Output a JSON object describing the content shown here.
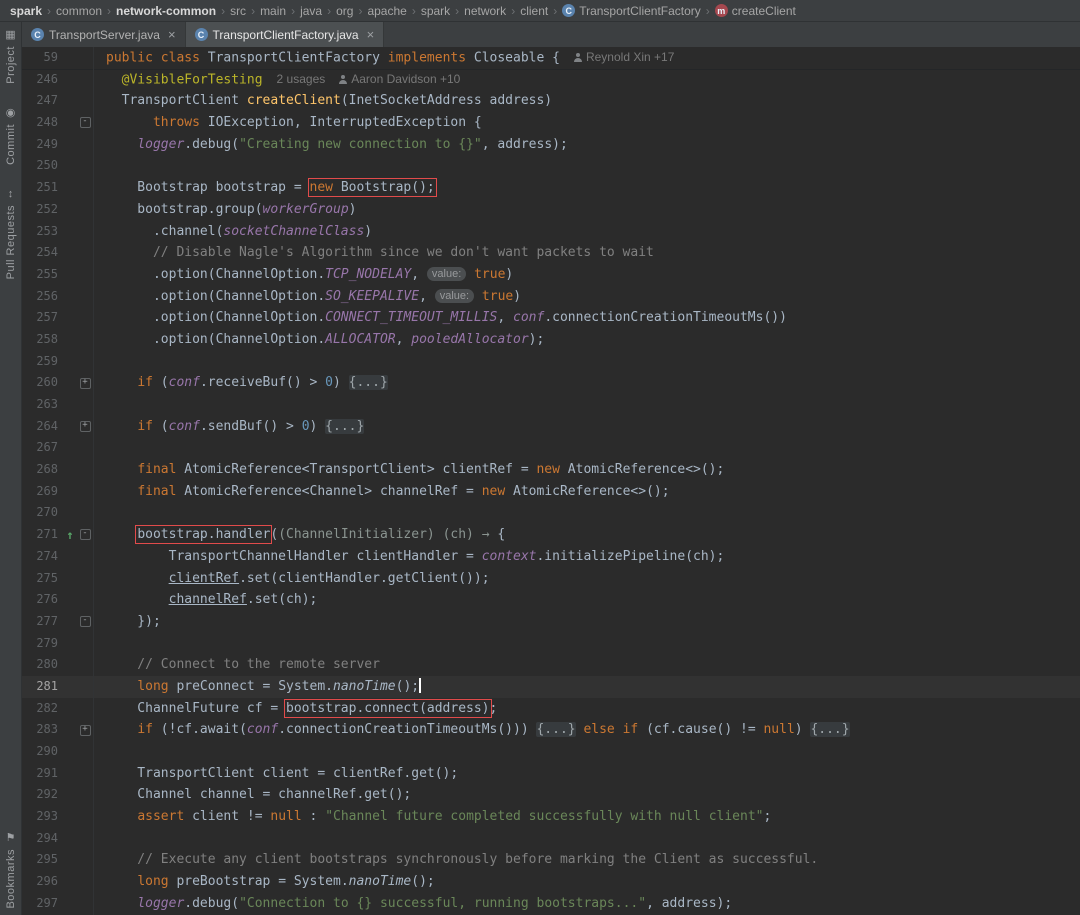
{
  "palette": {
    "editor_bg": "#2b2b2b",
    "panel_bg": "#3c3f41",
    "active_tab_bg": "#4c5052",
    "caret_row_bg": "#323232",
    "keyword": "#cc7832",
    "default_text": "#a9b7c6",
    "string": "#6a8759",
    "comment": "#808080",
    "field": "#9876aa",
    "method_decl": "#ffc66b",
    "annotation": "#bbb529",
    "number": "#6897bb",
    "line_number": "#606366",
    "inlay": "#787878",
    "highlight_box": "#e14b4b",
    "implement_marker": "#59a869"
  },
  "icons": {
    "class": "C",
    "method": "m",
    "close": "×",
    "separator": "›",
    "fold_open": "-",
    "fold_closed": "+",
    "override": "↑",
    "project": "▦",
    "commit": "◉",
    "pull-requests": "↕",
    "bookmarks": "⚑",
    "user": "css-person"
  },
  "breadcrumbs": {
    "separator": "›",
    "items": [
      {
        "label": "spark",
        "bold": true
      },
      {
        "label": "common"
      },
      {
        "label": "network-common",
        "bold": true
      },
      {
        "label": "src"
      },
      {
        "label": "main"
      },
      {
        "label": "java"
      },
      {
        "label": "org"
      },
      {
        "label": "apache"
      },
      {
        "label": "spark"
      },
      {
        "label": "network"
      },
      {
        "label": "client"
      },
      {
        "label": "TransportClientFactory",
        "icon": "class"
      },
      {
        "label": "createClient",
        "icon": "method"
      }
    ]
  },
  "tabs": {
    "items": [
      {
        "label": "TransportServer.java",
        "icon": "class",
        "active": false,
        "close": "×"
      },
      {
        "label": "TransportClientFactory.java",
        "icon": "class",
        "active": true,
        "close": "×"
      }
    ]
  },
  "tool_windows": {
    "top": [
      {
        "label": "Project",
        "icon": "project"
      },
      {
        "label": "Commit",
        "icon": "commit"
      },
      {
        "label": "Pull Requests",
        "icon": "pull-requests"
      }
    ],
    "bottom": [
      {
        "label": "Bookmarks",
        "icon": "bookmarks"
      }
    ]
  },
  "editor": {
    "lines": [
      {
        "n": "59",
        "sep": true,
        "tk": [
          {
            "t": "public ",
            "c": "kw"
          },
          {
            "t": "class ",
            "c": "kw"
          },
          {
            "t": "TransportClientFactory ",
            "c": "def"
          },
          {
            "t": "implements ",
            "c": "kw"
          },
          {
            "t": "Closeable {",
            "c": "def"
          },
          {
            "t": "Reynold Xin +17",
            "c": "inlay",
            "icon": "user"
          }
        ]
      },
      {
        "n": "246",
        "tk": [
          {
            "t": "  @VisibleForTesting",
            "c": "ann"
          },
          {
            "t": "2 usages",
            "c": "inlay"
          },
          {
            "t": "Aaron Davidson +10",
            "c": "inlay",
            "icon": "user"
          }
        ]
      },
      {
        "n": "247",
        "tk": [
          {
            "t": "  TransportClient ",
            "c": "def"
          },
          {
            "t": "createClient",
            "c": "mth"
          },
          {
            "t": "(InetSocketAddress address)",
            "c": "def"
          }
        ]
      },
      {
        "n": "248",
        "g": "o",
        "tk": [
          {
            "t": "      ",
            "c": "def"
          },
          {
            "t": "throws ",
            "c": "kw"
          },
          {
            "t": "IOException, InterruptedException {",
            "c": "def"
          }
        ]
      },
      {
        "n": "249",
        "tk": [
          {
            "t": "    ",
            "c": "def"
          },
          {
            "t": "logger",
            "c": "fld"
          },
          {
            "t": ".debug(",
            "c": "def"
          },
          {
            "t": "\"Creating new connection to {}\"",
            "c": "str"
          },
          {
            "t": ", address);",
            "c": "def"
          }
        ]
      },
      {
        "n": "250",
        "tk": []
      },
      {
        "n": "251",
        "tk": [
          {
            "t": "    Bootstrap bootstrap = ",
            "c": "def"
          },
          {
            "box": [
              {
                "t": "new ",
                "c": "kw"
              },
              {
                "t": "Bootstrap();",
                "c": "def"
              }
            ]
          }
        ]
      },
      {
        "n": "252",
        "tk": [
          {
            "t": "    bootstrap.group(",
            "c": "def"
          },
          {
            "t": "workerGroup",
            "c": "fld"
          },
          {
            "t": ")",
            "c": "def"
          }
        ]
      },
      {
        "n": "253",
        "tk": [
          {
            "t": "      .channel(",
            "c": "def"
          },
          {
            "t": "socketChannelClass",
            "c": "fld"
          },
          {
            "t": ")",
            "c": "def"
          }
        ]
      },
      {
        "n": "254",
        "tk": [
          {
            "t": "      // Disable Nagle's Algorithm since we don't want packets to wait",
            "c": "com"
          }
        ]
      },
      {
        "n": "255",
        "tk": [
          {
            "t": "      .option(ChannelOption.",
            "c": "def"
          },
          {
            "t": "TCP_NODELAY",
            "c": "fld"
          },
          {
            "t": ", ",
            "c": "def"
          },
          {
            "t": "value:",
            "c": "hint"
          },
          {
            "t": " ",
            "c": "def"
          },
          {
            "t": "true",
            "c": "kw"
          },
          {
            "t": ")",
            "c": "def"
          }
        ]
      },
      {
        "n": "256",
        "tk": [
          {
            "t": "      .option(ChannelOption.",
            "c": "def"
          },
          {
            "t": "SO_KEEPALIVE",
            "c": "fld"
          },
          {
            "t": ", ",
            "c": "def"
          },
          {
            "t": "value:",
            "c": "hint"
          },
          {
            "t": " ",
            "c": "def"
          },
          {
            "t": "true",
            "c": "kw"
          },
          {
            "t": ")",
            "c": "def"
          }
        ]
      },
      {
        "n": "257",
        "tk": [
          {
            "t": "      .option(ChannelOption.",
            "c": "def"
          },
          {
            "t": "CONNECT_TIMEOUT_MILLIS",
            "c": "fld"
          },
          {
            "t": ", ",
            "c": "def"
          },
          {
            "t": "conf",
            "c": "fld"
          },
          {
            "t": ".connectionCreationTimeoutMs())",
            "c": "def"
          }
        ]
      },
      {
        "n": "258",
        "tk": [
          {
            "t": "      .option(ChannelOption.",
            "c": "def"
          },
          {
            "t": "ALLOCATOR",
            "c": "fld"
          },
          {
            "t": ", ",
            "c": "def"
          },
          {
            "t": "pooledAllocator",
            "c": "fld"
          },
          {
            "t": ");",
            "c": "def"
          }
        ]
      },
      {
        "n": "259",
        "tk": []
      },
      {
        "n": "260",
        "g": "c",
        "tk": [
          {
            "t": "    ",
            "c": "def"
          },
          {
            "t": "if ",
            "c": "kw"
          },
          {
            "t": "(",
            "c": "def"
          },
          {
            "t": "conf",
            "c": "fld"
          },
          {
            "t": ".receiveBuf() > ",
            "c": "def"
          },
          {
            "t": "0",
            "c": "num"
          },
          {
            "t": ") ",
            "c": "def"
          },
          {
            "t": "{...}",
            "c": "fold"
          }
        ]
      },
      {
        "n": "263",
        "tk": []
      },
      {
        "n": "264",
        "g": "c",
        "tk": [
          {
            "t": "    ",
            "c": "def"
          },
          {
            "t": "if ",
            "c": "kw"
          },
          {
            "t": "(",
            "c": "def"
          },
          {
            "t": "conf",
            "c": "fld"
          },
          {
            "t": ".sendBuf() > ",
            "c": "def"
          },
          {
            "t": "0",
            "c": "num"
          },
          {
            "t": ") ",
            "c": "def"
          },
          {
            "t": "{...}",
            "c": "fold"
          }
        ]
      },
      {
        "n": "267",
        "tk": []
      },
      {
        "n": "268",
        "tk": [
          {
            "t": "    ",
            "c": "def"
          },
          {
            "t": "final ",
            "c": "kw"
          },
          {
            "t": "AtomicReference<TransportClient> clientRef = ",
            "c": "def"
          },
          {
            "t": "new ",
            "c": "kw"
          },
          {
            "t": "AtomicReference<>();",
            "c": "def"
          }
        ]
      },
      {
        "n": "269",
        "tk": [
          {
            "t": "    ",
            "c": "def"
          },
          {
            "t": "final ",
            "c": "kw"
          },
          {
            "t": "AtomicReference<Channel> channelRef = ",
            "c": "def"
          },
          {
            "t": "new ",
            "c": "kw"
          },
          {
            "t": "AtomicReference<>();",
            "c": "def"
          }
        ]
      },
      {
        "n": "270",
        "tk": []
      },
      {
        "n": "271",
        "g": "o",
        "m": true,
        "tk": [
          {
            "t": "    ",
            "c": "def"
          },
          {
            "box": [
              {
                "t": "bootstrap.handler",
                "c": "def"
              }
            ]
          },
          {
            "t": "(",
            "c": "def"
          },
          {
            "t": "(ChannelInitializer) (ch) → ",
            "c": "lam"
          },
          {
            "t": "{",
            "c": "def"
          }
        ]
      },
      {
        "n": "274",
        "tk": [
          {
            "t": "        TransportChannelHandler clientHandler = ",
            "c": "def"
          },
          {
            "t": "context",
            "c": "fld"
          },
          {
            "t": ".initializePipeline(ch);",
            "c": "def"
          }
        ]
      },
      {
        "n": "275",
        "tk": [
          {
            "t": "        ",
            "c": "def"
          },
          {
            "t": "clientRef",
            "c": "def",
            "u": true
          },
          {
            "t": ".set(clientHandler.getClient());",
            "c": "def"
          }
        ]
      },
      {
        "n": "276",
        "tk": [
          {
            "t": "        ",
            "c": "def"
          },
          {
            "t": "channelRef",
            "c": "def",
            "u": true
          },
          {
            "t": ".set(ch);",
            "c": "def"
          }
        ]
      },
      {
        "n": "277",
        "g": "e",
        "tk": [
          {
            "t": "    });",
            "c": "def"
          }
        ]
      },
      {
        "n": "279",
        "tk": []
      },
      {
        "n": "280",
        "tk": [
          {
            "t": "    // Connect to the remote server",
            "c": "com"
          }
        ]
      },
      {
        "n": "281",
        "cur": true,
        "tk": [
          {
            "t": "    ",
            "c": "def"
          },
          {
            "t": "long ",
            "c": "kw"
          },
          {
            "t": "preConnect = System.",
            "c": "def"
          },
          {
            "t": "nanoTime",
            "c": "def",
            "i": true
          },
          {
            "t": "();",
            "c": "def"
          },
          {
            "caret": true
          }
        ]
      },
      {
        "n": "282",
        "tk": [
          {
            "t": "    ChannelFuture cf = ",
            "c": "def"
          },
          {
            "box": [
              {
                "t": "bootstrap.connect(address)",
                "c": "def"
              }
            ]
          },
          {
            "t": ";",
            "c": "def"
          }
        ]
      },
      {
        "n": "283",
        "g": "c",
        "tk": [
          {
            "t": "    ",
            "c": "def"
          },
          {
            "t": "if ",
            "c": "kw"
          },
          {
            "t": "(!cf.await(",
            "c": "def"
          },
          {
            "t": "conf",
            "c": "fld"
          },
          {
            "t": ".connectionCreationTimeoutMs())) ",
            "c": "def"
          },
          {
            "t": "{...}",
            "c": "fold"
          },
          {
            "t": " ",
            "c": "def"
          },
          {
            "t": "else if ",
            "c": "kw"
          },
          {
            "t": "(cf.cause() != ",
            "c": "def"
          },
          {
            "t": "null",
            "c": "kw"
          },
          {
            "t": ") ",
            "c": "def"
          },
          {
            "t": "{...}",
            "c": "fold"
          }
        ]
      },
      {
        "n": "290",
        "tk": []
      },
      {
        "n": "291",
        "tk": [
          {
            "t": "    TransportClient client = clientRef.get();",
            "c": "def"
          }
        ]
      },
      {
        "n": "292",
        "tk": [
          {
            "t": "    Channel channel = channelRef.get();",
            "c": "def"
          }
        ]
      },
      {
        "n": "293",
        "tk": [
          {
            "t": "    ",
            "c": "def"
          },
          {
            "t": "assert ",
            "c": "kw"
          },
          {
            "t": "client != ",
            "c": "def"
          },
          {
            "t": "null",
            "c": "kw"
          },
          {
            "t": " : ",
            "c": "def"
          },
          {
            "t": "\"Channel future completed successfully with null client\"",
            "c": "str"
          },
          {
            "t": ";",
            "c": "def"
          }
        ]
      },
      {
        "n": "294",
        "tk": []
      },
      {
        "n": "295",
        "tk": [
          {
            "t": "    // Execute any client bootstraps synchronously before marking the Client as successful.",
            "c": "com"
          }
        ]
      },
      {
        "n": "296",
        "tk": [
          {
            "t": "    ",
            "c": "def"
          },
          {
            "t": "long ",
            "c": "kw"
          },
          {
            "t": "preBootstrap = System.",
            "c": "def"
          },
          {
            "t": "nanoTime",
            "c": "def",
            "i": true
          },
          {
            "t": "();",
            "c": "def"
          }
        ]
      },
      {
        "n": "297",
        "tk": [
          {
            "t": "    ",
            "c": "def"
          },
          {
            "t": "logger",
            "c": "fld"
          },
          {
            "t": ".debug(",
            "c": "def"
          },
          {
            "t": "\"Connection to {} successful, running bootstraps...\"",
            "c": "str"
          },
          {
            "t": ", address);",
            "c": "def"
          }
        ]
      }
    ]
  }
}
